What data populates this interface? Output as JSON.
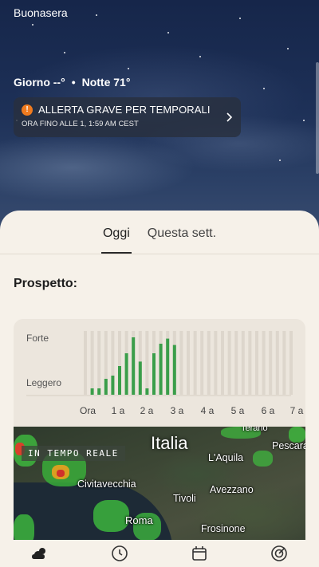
{
  "greeting": "Buonasera",
  "forecast": {
    "day_label": "Giorno --°",
    "separator": "•",
    "night_label": "Notte 71°"
  },
  "alert": {
    "title": "ALLERTA GRAVE PER TEMPORALI",
    "subtitle": "ORA FINO ALLE 1, 1:59 AM CEST",
    "icon": "alert-exclamation-icon",
    "color": "#f07b1f"
  },
  "tabs": [
    {
      "label": "Oggi",
      "active": true
    },
    {
      "label": "Questa sett.",
      "active": false
    }
  ],
  "outlook_title": "Prospetto:",
  "chart_data": {
    "type": "bar",
    "y_labels": [
      "Forte",
      "Leggero"
    ],
    "x_ticks": [
      "Ora",
      "1 a",
      "2 a",
      "3 a",
      "4 a",
      "5 a",
      "6 a",
      "7 a"
    ],
    "values": [
      0,
      0.1,
      0.1,
      0.25,
      0.3,
      0.45,
      0.65,
      0.9,
      0.52,
      0.1,
      0.65,
      0.8,
      0.88,
      0.78,
      0,
      0,
      0,
      0,
      0,
      0,
      0,
      0,
      0,
      0,
      0,
      0,
      0,
      0,
      0,
      0,
      0
    ],
    "ylim": [
      0,
      1
    ],
    "bar_color": "#3a9e4a",
    "empty_color": "#ddd6cc"
  },
  "map": {
    "country": "Italia",
    "realtime_label": "IN TEMPO REALE",
    "cities": [
      "Terano",
      "Pescara",
      "L'Aquila",
      "Civitavecchia",
      "Avezzano",
      "Tivoli",
      "Roma",
      "Frosinone"
    ]
  },
  "bottom_nav": [
    {
      "icon": "weather-cloud-icon",
      "active": true
    },
    {
      "icon": "clock-icon",
      "active": false
    },
    {
      "icon": "calendar-icon",
      "active": false
    },
    {
      "icon": "radar-icon",
      "active": false
    }
  ]
}
